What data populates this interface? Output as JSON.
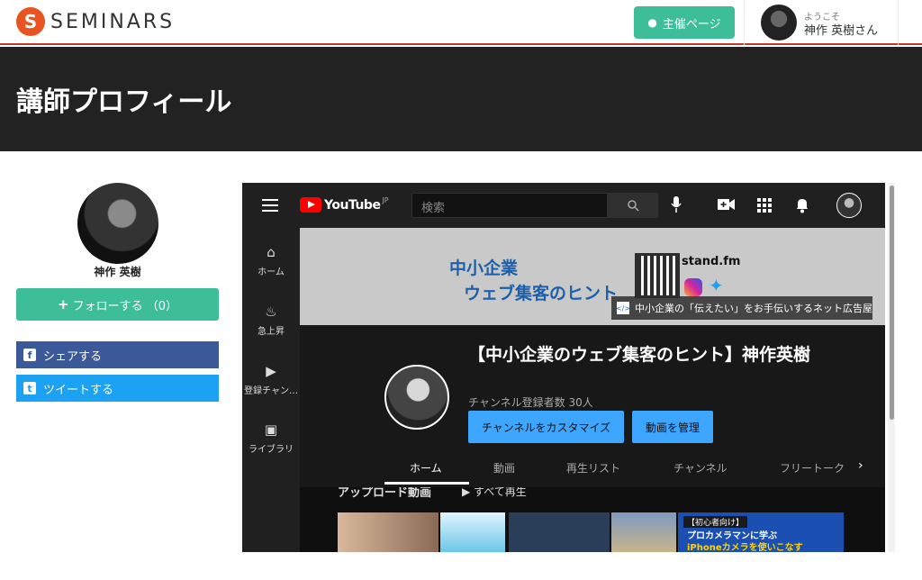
{
  "header": {
    "logo_mark": "S",
    "logo_text": "SEMINARS",
    "host_button": "主催ページ",
    "welcome": "ようこそ",
    "username": "神作 英樹さん"
  },
  "page": {
    "title": "講師プロフィール"
  },
  "profile": {
    "name": "神作 英樹",
    "follow_button": "フォローする （0）",
    "share_facebook": "シェアする",
    "share_twitter": "ツイートする"
  },
  "youtube": {
    "logo_word": "YouTube",
    "logo_region": "JP",
    "search_placeholder": "検索",
    "sidebar": [
      {
        "label": "ホーム",
        "icon": "home-icon"
      },
      {
        "label": "急上昇",
        "icon": "trending-icon"
      },
      {
        "label": "登録チャン…",
        "icon": "subscriptions-icon"
      },
      {
        "label": "ライブラリ",
        "icon": "library-icon"
      }
    ],
    "banner": {
      "line1": "中小企業",
      "line2": "ウェブ集客のヒント",
      "brand": "stand.fm",
      "link": "中小企業の「伝えたい」をお手伝いするネット広告屋"
    },
    "channel": {
      "title": "【中小企業のウェブ集客のヒント】神作英樹",
      "subscribers": "チャンネル登録者数 30人",
      "customize_button": "チャンネルをカスタマイズ",
      "manage_button": "動画を管理"
    },
    "tabs": [
      "ホーム",
      "動画",
      "再生リスト",
      "チャンネル",
      "フリートーク"
    ],
    "active_tab": "ホーム",
    "uploads": {
      "heading": "アップロード動画",
      "play_all": "すべて再生"
    },
    "thumbnail_text": {
      "badge": "【初心者向け】",
      "line1": "プロカメラマンに学ぶ",
      "line2": "iPhoneカメラを使いこなす"
    }
  },
  "colors": {
    "accent_green": "#3dbd98",
    "facebook": "#3b5998",
    "twitter": "#1da1f2",
    "logo_orange": "#e8531f",
    "yt_blue": "#3ea6ff"
  }
}
